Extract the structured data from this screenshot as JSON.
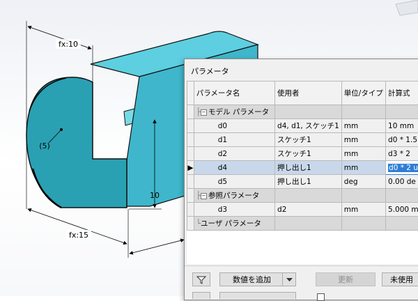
{
  "model": {
    "dim_top": "fx:10",
    "dim_radius": "(5)",
    "dim_height": "10",
    "dim_bottom": "fx:15"
  },
  "dialog": {
    "title": "パラメータ",
    "columns": [
      "パラメータ名",
      "使用者",
      "単位/タイプ",
      "計算式"
    ],
    "rows": [
      {
        "kind": "group",
        "name": "モデル パラメータ",
        "used_by": "",
        "unit": "",
        "expr": ""
      },
      {
        "kind": "param",
        "name": "d0",
        "used_by": "d4, d1, スケッチ1",
        "unit": "mm",
        "expr": "10 mm"
      },
      {
        "kind": "param",
        "name": "d1",
        "used_by": "スケッチ1",
        "unit": "mm",
        "expr": "d0 * 1.5"
      },
      {
        "kind": "param",
        "name": "d2",
        "used_by": "スケッチ1",
        "unit": "mm",
        "expr": "d3 * 2"
      },
      {
        "kind": "param",
        "name": "d4",
        "used_by": "押し出し1",
        "unit": "mm",
        "expr": "d0 * 2 u",
        "selected": true
      },
      {
        "kind": "param",
        "name": "d5",
        "used_by": "押し出し1",
        "unit": "deg",
        "expr": "0.00 de"
      },
      {
        "kind": "group",
        "name": "参照パラメータ",
        "used_by": "",
        "unit": "",
        "expr": ""
      },
      {
        "kind": "param",
        "name": "d3",
        "used_by": "d2",
        "unit": "mm",
        "expr": "5.000 m"
      },
      {
        "kind": "group",
        "name": "ユーザ パラメータ",
        "used_by": "",
        "unit": "",
        "expr": ""
      }
    ],
    "buttons": {
      "add_numeric": "数値を追加",
      "update": "更新",
      "unused": "未使用"
    }
  }
}
